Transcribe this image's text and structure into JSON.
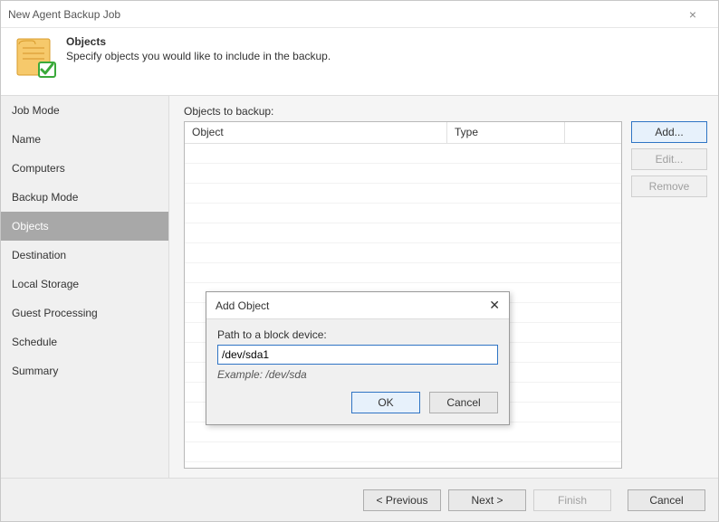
{
  "window": {
    "title": "New Agent Backup Job"
  },
  "header": {
    "title": "Objects",
    "subtitle": "Specify objects you would like to include in the backup."
  },
  "sidebar": {
    "items": [
      {
        "label": "Job Mode"
      },
      {
        "label": "Name"
      },
      {
        "label": "Computers"
      },
      {
        "label": "Backup Mode"
      },
      {
        "label": "Objects",
        "selected": true
      },
      {
        "label": "Destination"
      },
      {
        "label": "Local Storage"
      },
      {
        "label": "Guest Processing"
      },
      {
        "label": "Schedule"
      },
      {
        "label": "Summary"
      }
    ]
  },
  "content": {
    "label": "Objects to backup:",
    "columns": {
      "object": "Object",
      "type": "Type"
    }
  },
  "buttons": {
    "add": "Add...",
    "edit": "Edit...",
    "remove": "Remove"
  },
  "modal": {
    "title": "Add Object",
    "label": "Path to a block device:",
    "value": "/dev/sda1",
    "example": "Example: /dev/sda",
    "ok": "OK",
    "cancel": "Cancel"
  },
  "footer": {
    "previous": "< Previous",
    "next": "Next >",
    "finish": "Finish",
    "cancel": "Cancel"
  }
}
